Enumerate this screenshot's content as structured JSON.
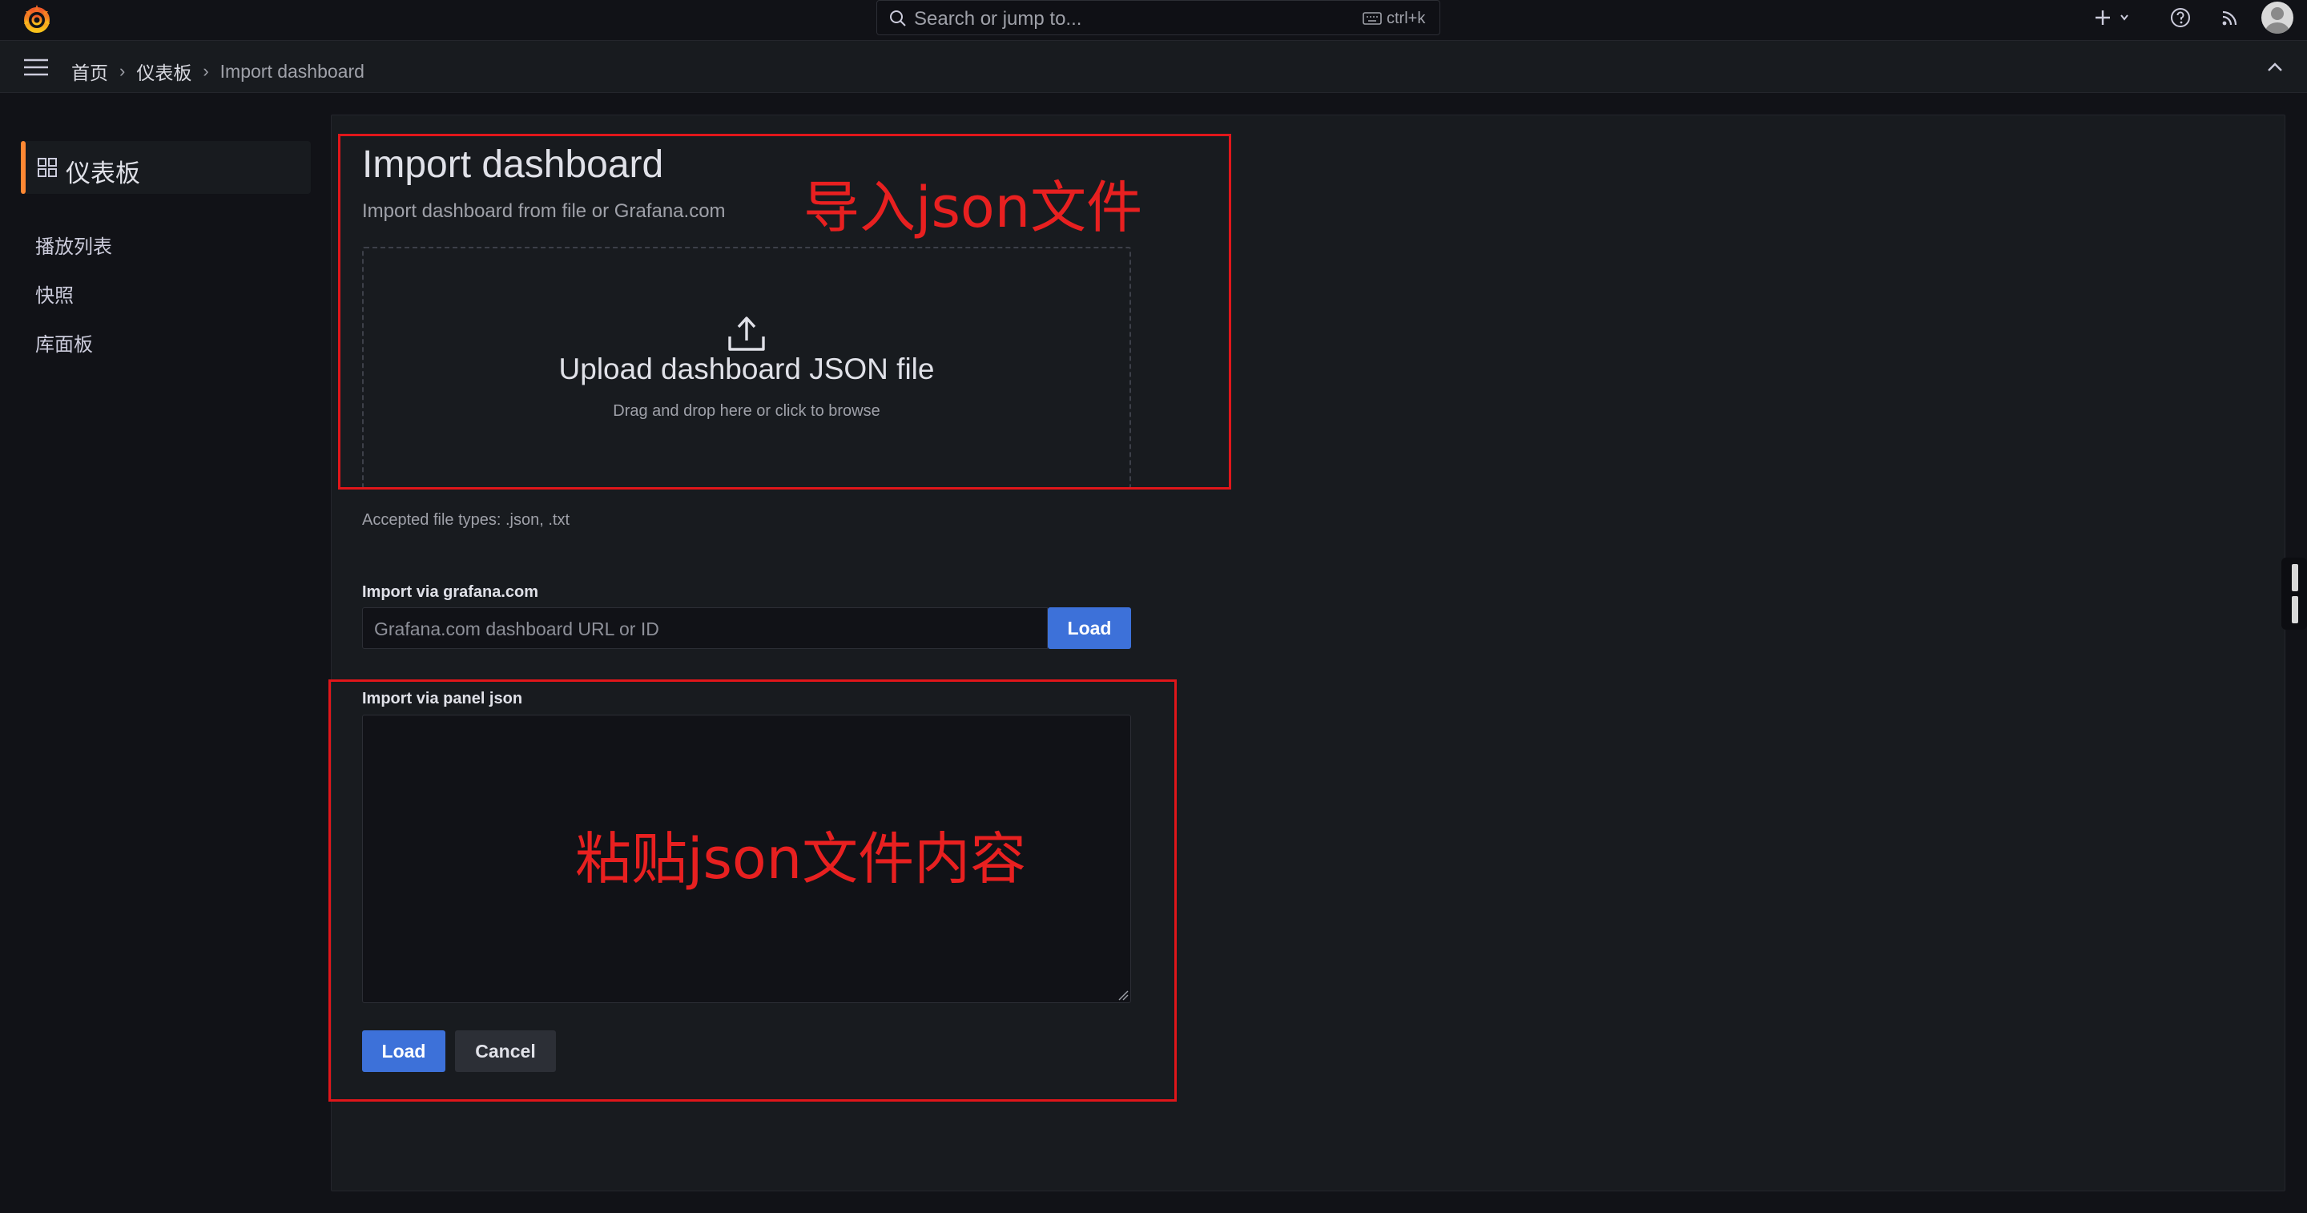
{
  "topbar": {
    "search_placeholder": "Search or jump to...",
    "search_shortcut": "ctrl+k",
    "icons": [
      "grafana-logo-icon",
      "plus-icon",
      "help-icon",
      "rss-icon",
      "avatar"
    ]
  },
  "breadcrumb": {
    "home": "首页",
    "dashboards": "仪表板",
    "current": "Import dashboard",
    "separator": "›"
  },
  "sidebar": {
    "active_label": "仪表板",
    "items": [
      {
        "label": "播放列表"
      },
      {
        "label": "快照"
      },
      {
        "label": "库面板"
      }
    ]
  },
  "main": {
    "title": "Import dashboard",
    "subtitle": "Import dashboard from file or Grafana.com",
    "upload": {
      "title": "Upload dashboard JSON file",
      "hint": "Drag and drop here or click to browse"
    },
    "accepted_types": "Accepted file types: .json, .txt",
    "gcom": {
      "label": "Import via grafana.com",
      "placeholder": "Grafana.com dashboard URL or ID",
      "button": "Load"
    },
    "panel_json": {
      "label": "Import via panel json",
      "load_button": "Load",
      "cancel_button": "Cancel"
    }
  },
  "annotations": {
    "upload_note": "导入json文件",
    "paste_note": "粘贴json文件内容",
    "color": "#e0161a"
  },
  "colors": {
    "background": "#111217",
    "panel": "#181b1f",
    "primary_button": "#3d71d9",
    "active_accent": "#ff8833"
  }
}
